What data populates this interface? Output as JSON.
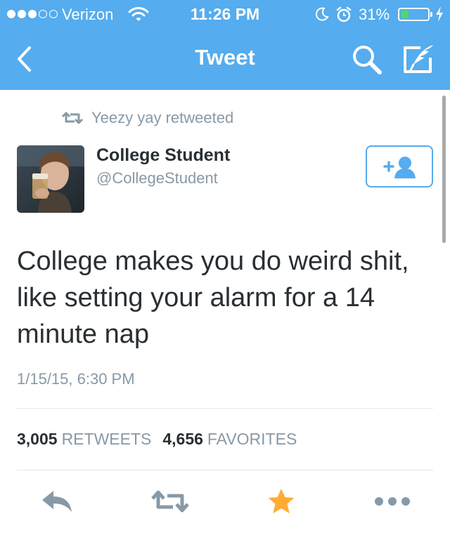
{
  "status_bar": {
    "carrier": "Verizon",
    "time": "11:26 PM",
    "battery_percent": "31%",
    "battery_level": 0.31,
    "signal_bars": 3,
    "signal_total": 5
  },
  "nav": {
    "title": "Tweet",
    "back_icon": "chevron-left-icon",
    "search_icon": "search-icon",
    "compose_icon": "compose-icon"
  },
  "retweet_context": {
    "text": "Yeezy yay retweeted",
    "icon": "retweet-icon"
  },
  "author": {
    "name": "College Student",
    "handle": "@CollegeStudent",
    "follow_icon": "add-user-icon"
  },
  "tweet": {
    "text": "College makes you do weird shit, like setting your alarm for a 14 minute nap",
    "timestamp": "1/15/15, 6:30 PM"
  },
  "stats": {
    "retweets_count": "3,005",
    "retweets_label": "RETWEETS",
    "favorites_count": "4,656",
    "favorites_label": "FAVORITES"
  },
  "actions": {
    "reply_icon": "reply-icon",
    "retweet_icon": "retweet-icon",
    "favorite_icon": "star-icon",
    "more_icon": "more-icon"
  },
  "colors": {
    "brand_blue": "#55acee",
    "text_dark": "#292f33",
    "text_gray": "#8899a6",
    "favorite_orange": "#ffac33",
    "action_gray": "#8899a6",
    "battery_green": "#4cd964"
  }
}
